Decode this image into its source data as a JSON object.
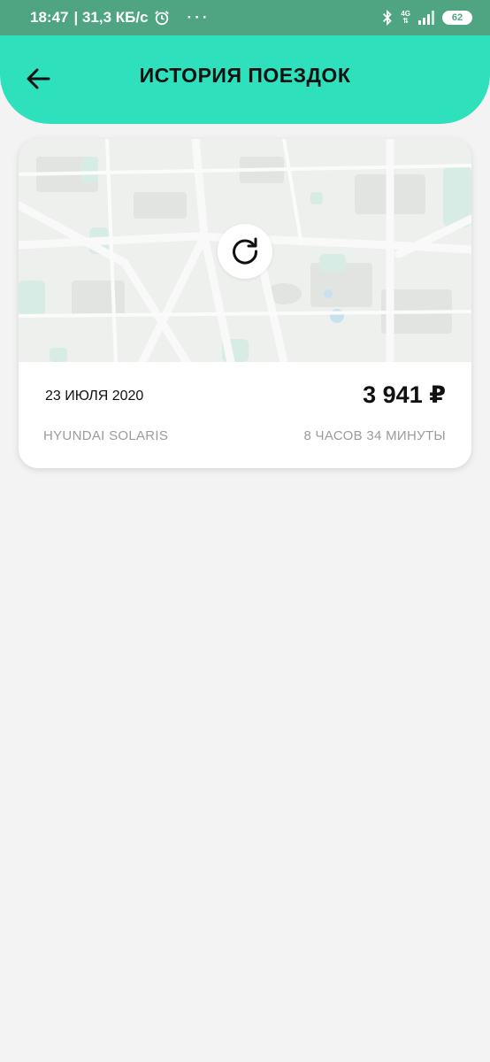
{
  "status_bar": {
    "time": "18:47",
    "speed": "| 31,3 КБ/с",
    "more": "···",
    "network": "4G",
    "battery": "62"
  },
  "header": {
    "title": "ИСТОРИЯ ПОЕЗДОК",
    "back_icon": "arrow-left-icon"
  },
  "trip": {
    "date": "23 ИЮЛЯ 2020",
    "price": "3 941 ₽",
    "car": "HYUNDAI SOLARIS",
    "duration": "8 ЧАСОВ 34 МИНУТЫ",
    "reload_icon": "reload-icon"
  },
  "colors": {
    "header": "#2ee0bb",
    "status_bar": "#4fa582",
    "background": "#f3f3f3"
  }
}
